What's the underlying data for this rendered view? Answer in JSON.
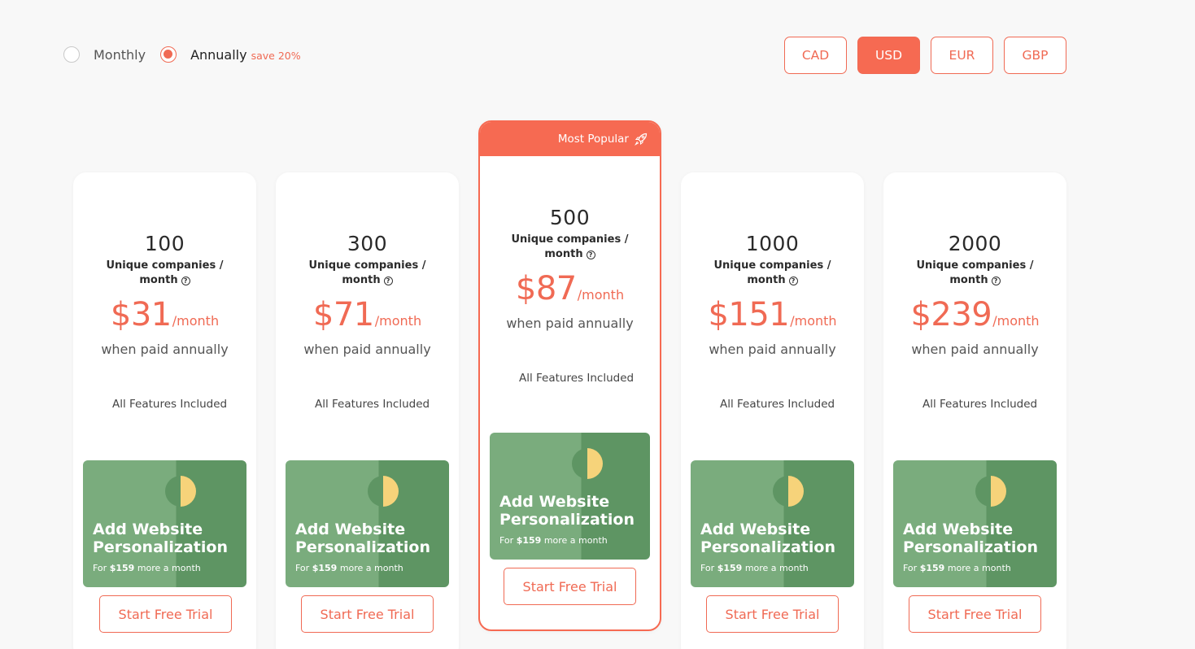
{
  "billing": {
    "monthly_label": "Monthly",
    "annual_label": "Annually",
    "annual_save": "save 20%",
    "selected": "annually"
  },
  "currencies": [
    "CAD",
    "USD",
    "EUR",
    "GBP"
  ],
  "selected_currency": "USD",
  "accent_color": "#f66a52",
  "popular_badge": "Most Popular",
  "plans": [
    {
      "quantity": "100",
      "unit": "Unique companies /",
      "unit2": "month",
      "price": "$31",
      "period": "/month",
      "note": "when paid annually",
      "features": "All Features Included",
      "promo_title1": "Add Website",
      "promo_title2": "Personalization",
      "promo_prefix": "For",
      "promo_price": "$159",
      "promo_suffix": "more a month",
      "cta": "Start Free Trial"
    },
    {
      "quantity": "300",
      "unit": "Unique companies /",
      "unit2": "month",
      "price": "$71",
      "period": "/month",
      "note": "when paid annually",
      "features": "All Features Included",
      "promo_title1": "Add Website",
      "promo_title2": "Personalization",
      "promo_prefix": "For",
      "promo_price": "$159",
      "promo_suffix": "more a month",
      "cta": "Start Free Trial"
    },
    {
      "quantity": "500",
      "unit": "Unique companies /",
      "unit2": "month",
      "price": "$87",
      "period": "/month",
      "note": "when paid annually",
      "features": "All Features Included",
      "promo_title1": "Add Website",
      "promo_title2": "Personalization",
      "promo_prefix": "For",
      "promo_price": "$159",
      "promo_suffix": "more a month",
      "cta": "Start Free Trial"
    },
    {
      "quantity": "1000",
      "unit": "Unique companies /",
      "unit2": "month",
      "price": "$151",
      "period": "/month",
      "note": "when paid annually",
      "features": "All Features Included",
      "promo_title1": "Add Website",
      "promo_title2": "Personalization",
      "promo_prefix": "For",
      "promo_price": "$159",
      "promo_suffix": "more a month",
      "cta": "Start Free Trial"
    },
    {
      "quantity": "2000",
      "unit": "Unique companies /",
      "unit2": "month",
      "price": "$239",
      "period": "/month",
      "note": "when paid annually",
      "features": "All Features Included",
      "promo_title1": "Add Website",
      "promo_title2": "Personalization",
      "promo_prefix": "For",
      "promo_price": "$159",
      "promo_suffix": "more a month",
      "cta": "Start Free Trial"
    }
  ]
}
